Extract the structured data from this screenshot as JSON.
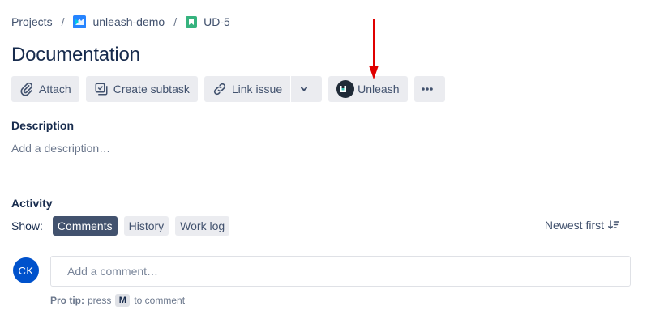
{
  "breadcrumb": {
    "root": "Projects",
    "project": "unleash-demo",
    "issue_key": "UD-5",
    "separator": "/"
  },
  "issue": {
    "title": "Documentation"
  },
  "toolbar": {
    "attach_label": "Attach",
    "create_subtask_label": "Create subtask",
    "link_issue_label": "Link issue",
    "unleash_label": "Unleash"
  },
  "description": {
    "heading": "Description",
    "placeholder": "Add a description…"
  },
  "activity": {
    "heading": "Activity",
    "show_label": "Show:",
    "filters": [
      "Comments",
      "History",
      "Work log"
    ],
    "active_filter": "Comments",
    "sort_label": "Newest first"
  },
  "comment": {
    "avatar_initials": "CK",
    "placeholder": "Add a comment…",
    "pro_tip_label": "Pro tip:",
    "pro_tip_press": "press",
    "pro_tip_key": "M",
    "pro_tip_suffix": "to comment"
  },
  "colors": {
    "text_primary": "#172B4D",
    "button_bg": "#EBECF0",
    "active_chip_bg": "#42526E",
    "avatar_bg": "#0052CC",
    "annotation_arrow": "#E00000",
    "issue_type_green": "#36B37E",
    "project_icon_blue": "#2684FF"
  },
  "icons": {
    "project": "project-icon",
    "issue_type": "story-icon",
    "attach": "paperclip-icon",
    "subtask": "subtask-icon",
    "link": "link-icon",
    "dropdown": "chevron-down-icon",
    "unleash": "unleash-logo-icon",
    "more": "more-icon",
    "sort": "sort-descending-icon"
  }
}
